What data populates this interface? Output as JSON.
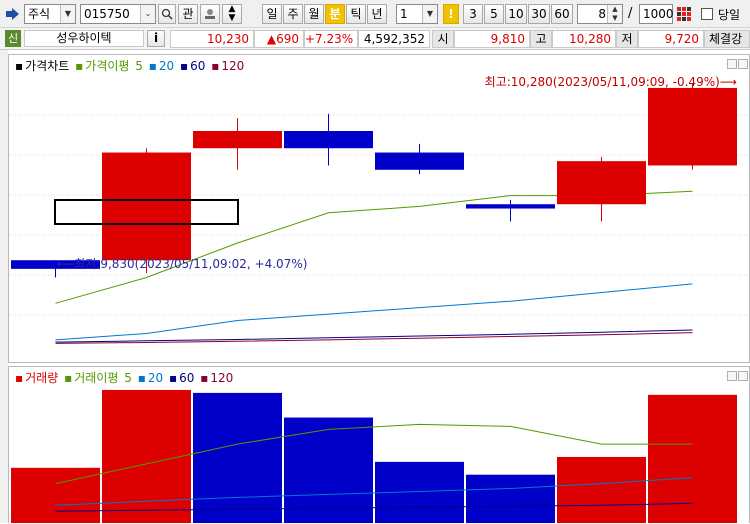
{
  "toolbar": {
    "market_select": "주식",
    "code_value": "015750",
    "btn_gwan": "관",
    "periods": [
      "일",
      "주",
      "월",
      "분",
      "틱",
      "년"
    ],
    "active_period": "분",
    "minute_value": "1",
    "minute_options": [
      "3",
      "5",
      "10",
      "30",
      "60"
    ],
    "count_value": "8",
    "separator": "/",
    "total_value": "1000",
    "today_label": "당일"
  },
  "quote": {
    "badge": "신",
    "stock_name": "성우하이텍",
    "info_label": "i",
    "price": "10,230",
    "change": "▲690",
    "change_pct": "+7.23%",
    "volume": "4,592,352",
    "open_label": "시",
    "open": "9,810",
    "high_label": "고",
    "high": "10,280",
    "low_label": "저",
    "low": "9,720",
    "extra_label": "체결강"
  },
  "price_legend": {
    "name": "가격차트",
    "ma_name": "가격이평",
    "ma5": "5",
    "ma20": "20",
    "ma60": "60",
    "ma120": "120"
  },
  "volume_legend": {
    "name": "거래량",
    "ma_name": "거래이평",
    "ma5": "5",
    "ma20": "20",
    "ma60": "60",
    "ma120": "120"
  },
  "colors": {
    "up": "#dd0000",
    "down": "#0000c8",
    "ma5": "#559900",
    "ma20": "#0077cc",
    "ma60": "#000088",
    "ma120": "#8a0033",
    "annotation": "#c00000",
    "annotation_low": "#2a2aa0"
  },
  "chart_data": [
    {
      "type": "candlestick",
      "title": "가격차트",
      "x": [
        1,
        2,
        3,
        4,
        5,
        6,
        7,
        8
      ],
      "open": [
        9870,
        9870,
        10130,
        10170,
        10120,
        10000,
        10000,
        10090
      ],
      "close": [
        9850,
        10120,
        10170,
        10130,
        10080,
        9990,
        10100,
        10270
      ],
      "high": [
        9870,
        10130,
        10200,
        10210,
        10140,
        10010,
        10110,
        10280
      ],
      "low": [
        9830,
        9840,
        10080,
        10090,
        10070,
        9960,
        9960,
        10080
      ],
      "ma5": [
        9770,
        9830,
        9910,
        9980,
        9995,
        10020,
        10020,
        10030
      ],
      "ma20": [
        9685,
        9700,
        9730,
        9745,
        9760,
        9775,
        9795,
        9815
      ],
      "ma60": [
        9680,
        9683,
        9686,
        9690,
        9694,
        9698,
        9703,
        9708
      ],
      "ma120": [
        9677,
        9679,
        9682,
        9685,
        9689,
        9693,
        9697,
        9702
      ],
      "ylim": [
        9650,
        10300
      ],
      "annotations": {
        "high": "최고:10,280(2023/05/11,09:09, -0.49%)⟶",
        "low": "⟵최저:9,830(2023/05/11,09:02, +4.07%)"
      }
    },
    {
      "type": "bar",
      "title": "거래량",
      "x": [
        1,
        2,
        3,
        4,
        5,
        6,
        7,
        8
      ],
      "values": [
        56000,
        135000,
        132000,
        107000,
        62000,
        49000,
        67000,
        130000
      ],
      "direction": [
        "up",
        "up",
        "down",
        "down",
        "down",
        "down",
        "up",
        "up"
      ],
      "ma5": [
        40000,
        60000,
        80000,
        95000,
        100000,
        98000,
        80000,
        80000
      ],
      "ma20": [
        18000,
        22000,
        26000,
        29000,
        32000,
        35000,
        40000,
        46000
      ],
      "ma60": [
        12000,
        13000,
        14000,
        15000,
        16000,
        17000,
        18000,
        20000
      ],
      "ylim": [
        0,
        140000
      ]
    }
  ]
}
